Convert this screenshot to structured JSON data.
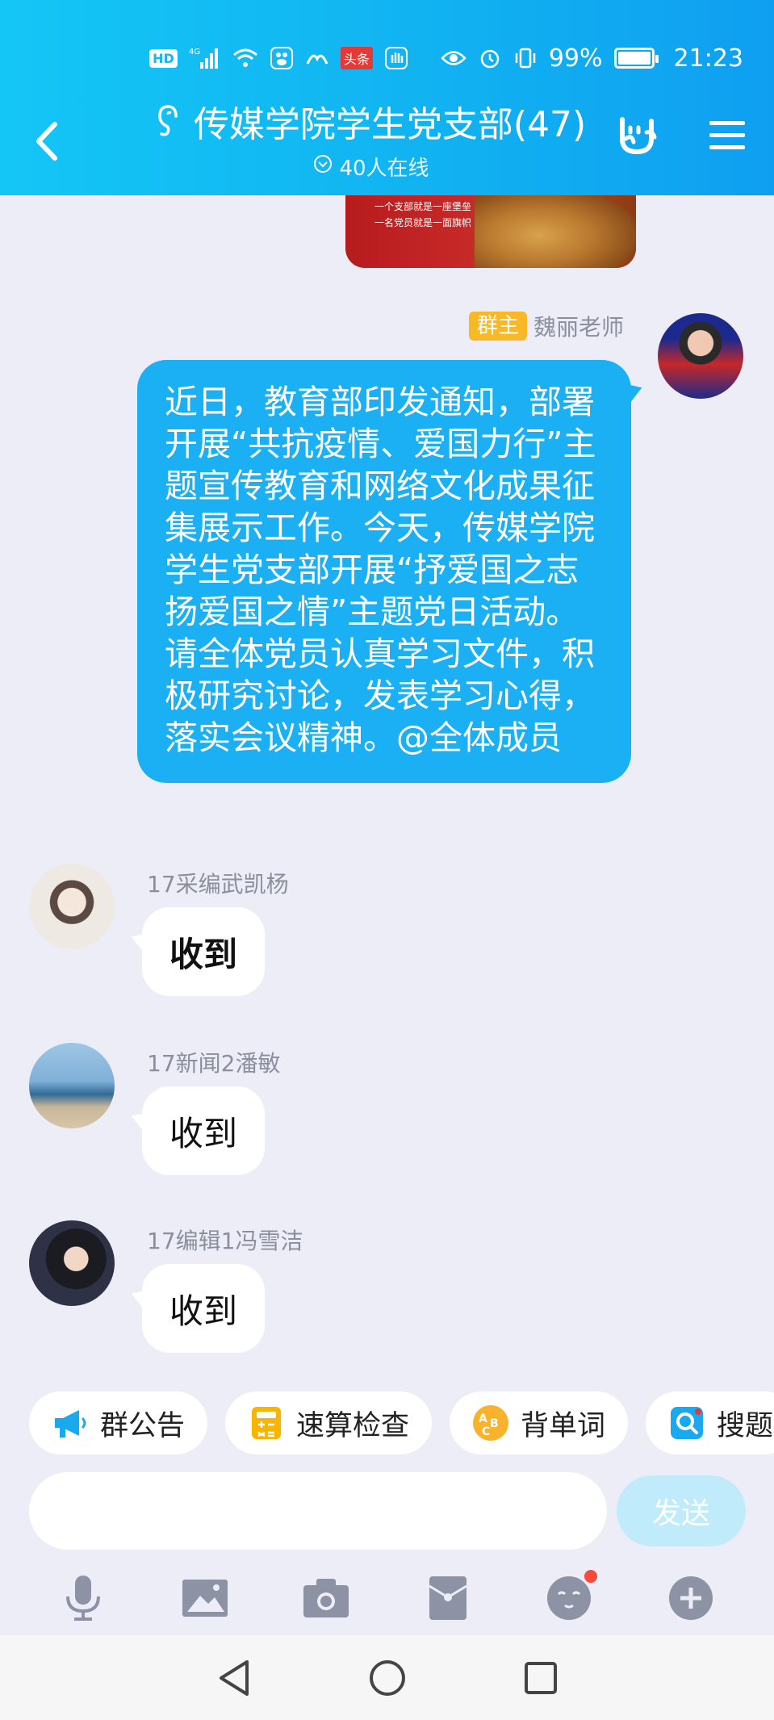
{
  "status_bar": {
    "hd": "HD",
    "network": "4G",
    "toutiao": "头条",
    "battery_pct": "99%",
    "time": "21:23"
  },
  "header": {
    "title": "传媒学院学生党支部(47)",
    "online": "40人在线"
  },
  "image_message": {
    "line1": "一个支部就是一座堡垒",
    "line2": "一名党员就是一面旗帜"
  },
  "owner_message": {
    "badge": "群主",
    "sender": "魏丽老师",
    "text": "近日，教育部印发通知，部署开展“共抗疫情、爱国力行”主题宣传教育和网络文化成果征集展示工作。今天，传媒学院学生党支部开展“抒爱国之志　扬爱国之情”主题党日活动。请全体党员认真学习文件，积极研究讨论，发表学习心得，落实会议精神。@全体成员"
  },
  "messages": [
    {
      "sender": "17采编武凯杨",
      "text": "收到"
    },
    {
      "sender": "17新闻2潘敏",
      "text": "收到"
    },
    {
      "sender": "17编辑1冯雪洁",
      "text": "收到"
    }
  ],
  "chips": [
    "群公告",
    "速算检查",
    "背单词",
    "搜题"
  ],
  "input": {
    "placeholder": "",
    "send": "发送"
  },
  "colors": {
    "accent": "#1bb0f4",
    "owner_badge": "#f9b926",
    "send_disabled": "#c0ebfb"
  }
}
